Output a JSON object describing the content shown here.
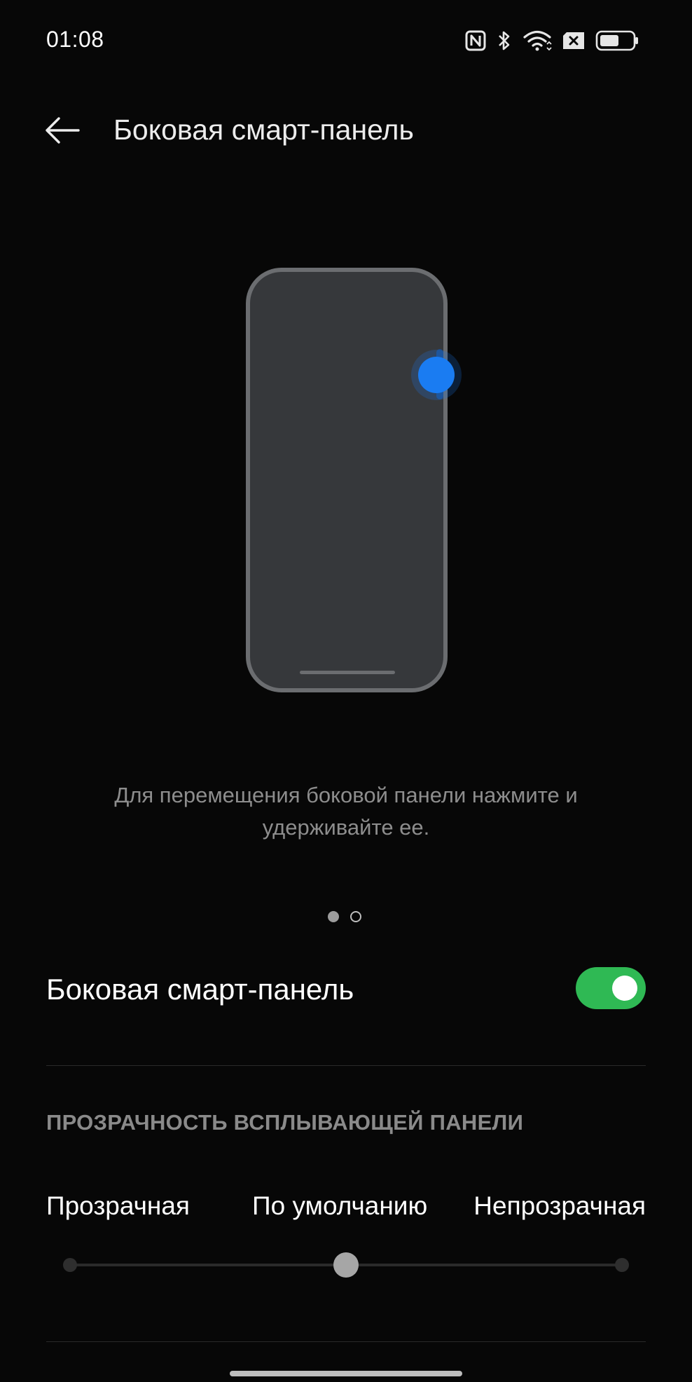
{
  "status_bar": {
    "time": "01:08",
    "icons": [
      "nfc-icon",
      "bluetooth-icon",
      "wifi-icon",
      "no-sim-icon",
      "battery-icon"
    ]
  },
  "app_bar": {
    "back_icon": "back-arrow-icon",
    "title": "Боковая смарт-панель"
  },
  "illustration": {
    "accent_color": "#1a7cf2",
    "phone_fill": "#36383b",
    "phone_border": "#6b6d70"
  },
  "hint": {
    "text": "Для перемещения боковой панели нажмите и удерживайте ее."
  },
  "pager": {
    "pages": 2,
    "current": 1
  },
  "settings": {
    "smart_sidebar": {
      "label": "Боковая смарт-панель",
      "enabled": true,
      "on_color": "#2fb954"
    },
    "transparency": {
      "header": "ПРОЗРАЧНОСТЬ ВСПЛЫВАЮЩЕЙ ПАНЕЛИ",
      "levels": [
        "Прозрачная",
        "По умолчанию",
        "Непрозрачная"
      ],
      "selected_index": 1
    }
  }
}
